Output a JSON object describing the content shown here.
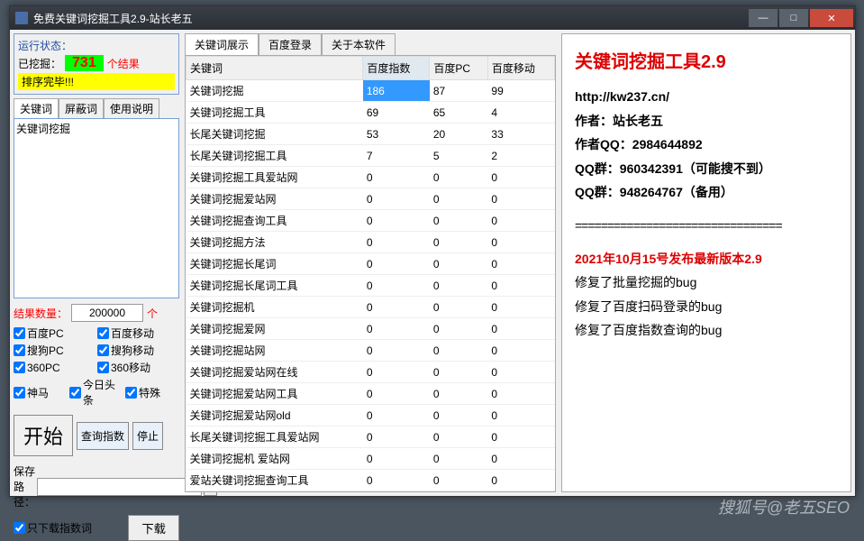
{
  "window": {
    "title": "免费关键词挖掘工具2.9-站长老五"
  },
  "status": {
    "title": "运行状态：",
    "dug_label": "已挖掘：",
    "count": "731",
    "unit": "个结果",
    "done": "排序完毕!!!"
  },
  "left_tabs": [
    "关键词",
    "屏蔽词",
    "使用说明"
  ],
  "keyword_text": "关键词挖掘",
  "result": {
    "label": "结果数量：",
    "value": "200000",
    "unit": "个"
  },
  "checks": [
    [
      {
        "label": "百度PC",
        "checked": true
      },
      {
        "label": "百度移动",
        "checked": true
      }
    ],
    [
      {
        "label": "搜狗PC",
        "checked": true
      },
      {
        "label": "搜狗移动",
        "checked": true
      }
    ],
    [
      {
        "label": "360PC",
        "checked": true
      },
      {
        "label": "360移动",
        "checked": true
      }
    ],
    [
      {
        "label": "神马",
        "checked": true
      },
      {
        "label": "今日头条",
        "checked": true
      },
      {
        "label": "特殊",
        "checked": true
      }
    ]
  ],
  "buttons": {
    "start": "开始",
    "query": "查询指数",
    "stop": "停止"
  },
  "save": {
    "label": "保存路径：",
    "value": ""
  },
  "download": {
    "only_index": "只下载指数词",
    "btn": "下载"
  },
  "main_tabs": [
    "关键词展示",
    "百度登录",
    "关于本软件"
  ],
  "table": {
    "headers": [
      "关键词",
      "百度指数",
      "百度PC",
      "百度移动"
    ],
    "rows": [
      {
        "kw": "关键词挖掘",
        "idx": "186",
        "pc": "87",
        "mb": "99",
        "sel": true
      },
      {
        "kw": "关键词挖掘工具",
        "idx": "69",
        "pc": "65",
        "mb": "4"
      },
      {
        "kw": "长尾关键词挖掘",
        "idx": "53",
        "pc": "20",
        "mb": "33"
      },
      {
        "kw": "长尾关键词挖掘工具",
        "idx": "7",
        "pc": "5",
        "mb": "2"
      },
      {
        "kw": "关键词挖掘工具爱站网",
        "idx": "0",
        "pc": "0",
        "mb": "0"
      },
      {
        "kw": "关键词挖掘爱站网",
        "idx": "0",
        "pc": "0",
        "mb": "0"
      },
      {
        "kw": "关键词挖掘查询工具",
        "idx": "0",
        "pc": "0",
        "mb": "0"
      },
      {
        "kw": "关键词挖掘方法",
        "idx": "0",
        "pc": "0",
        "mb": "0"
      },
      {
        "kw": "关键词挖掘长尾词",
        "idx": "0",
        "pc": "0",
        "mb": "0"
      },
      {
        "kw": "关键词挖掘长尾词工具",
        "idx": "0",
        "pc": "0",
        "mb": "0"
      },
      {
        "kw": "关键词挖掘机",
        "idx": "0",
        "pc": "0",
        "mb": "0"
      },
      {
        "kw": "关键词挖掘爱网",
        "idx": "0",
        "pc": "0",
        "mb": "0"
      },
      {
        "kw": "关键词挖掘站网",
        "idx": "0",
        "pc": "0",
        "mb": "0"
      },
      {
        "kw": "关键词挖掘爱站网在线",
        "idx": "0",
        "pc": "0",
        "mb": "0"
      },
      {
        "kw": "关键词挖掘爱站网工具",
        "idx": "0",
        "pc": "0",
        "mb": "0"
      },
      {
        "kw": "关键词挖掘爱站网old",
        "idx": "0",
        "pc": "0",
        "mb": "0"
      },
      {
        "kw": "长尾关键词挖掘工具爱站网",
        "idx": "0",
        "pc": "0",
        "mb": "0"
      },
      {
        "kw": "关键词挖掘机 爱站网",
        "idx": "0",
        "pc": "0",
        "mb": "0"
      },
      {
        "kw": "爱站关键词挖掘查询工具",
        "idx": "0",
        "pc": "0",
        "mb": "0"
      }
    ]
  },
  "info": {
    "title": "关键词挖掘工具2.9",
    "url": "http://kw237.cn/",
    "author": "作者：站长老五",
    "qq": "作者QQ：2984644892",
    "group1": "QQ群：960342391（可能搜不到）",
    "group2": "QQ群：948264767（备用）",
    "release": "2021年10月15号发布最新版本2.9",
    "changes": [
      "修复了批量挖掘的bug",
      "修复了百度扫码登录的bug",
      "修复了百度指数查询的bug"
    ]
  },
  "watermark": "搜狐号@老五SEO"
}
